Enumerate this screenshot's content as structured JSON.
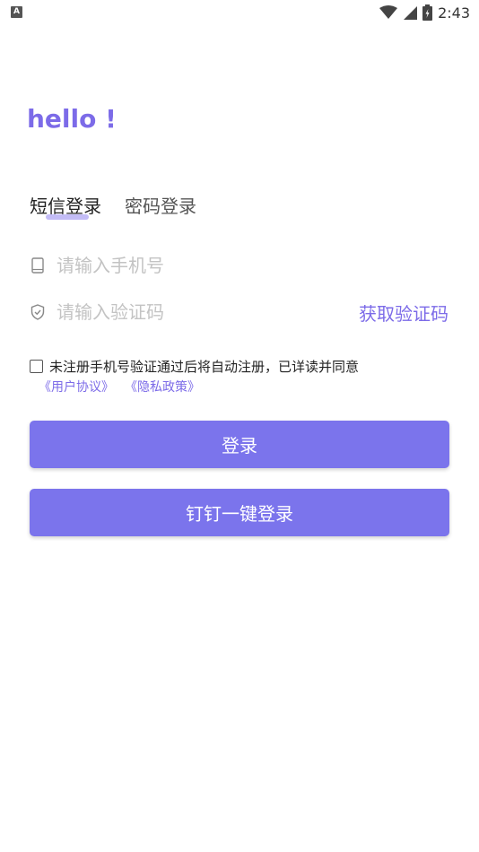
{
  "status_bar": {
    "app_indicator": "A",
    "time": "2:43",
    "icons": [
      "wifi-icon",
      "signal-icon",
      "battery-icon"
    ]
  },
  "greeting": "hello !",
  "tabs": [
    {
      "label": "短信登录",
      "active": true
    },
    {
      "label": "密码登录",
      "active": false
    }
  ],
  "phone_field": {
    "icon": "phone-icon",
    "placeholder": "请输入手机号",
    "value": ""
  },
  "code_field": {
    "icon": "shield-icon",
    "placeholder": "请输入验证码",
    "value": "",
    "get_code_label": "获取验证码"
  },
  "agreement": {
    "checked": false,
    "text": "未注册手机号验证通过后将自动注册，已详读并同意",
    "links": [
      "《用户协议》",
      "《隐私政策》"
    ]
  },
  "buttons": {
    "login_label": "登录",
    "dingtalk_label": "钉钉一键登录"
  },
  "colors": {
    "accent": "#7c6be8",
    "button": "#7b74ec",
    "tab_underline": "#b9b0f5",
    "placeholder": "#c3c3c3"
  }
}
